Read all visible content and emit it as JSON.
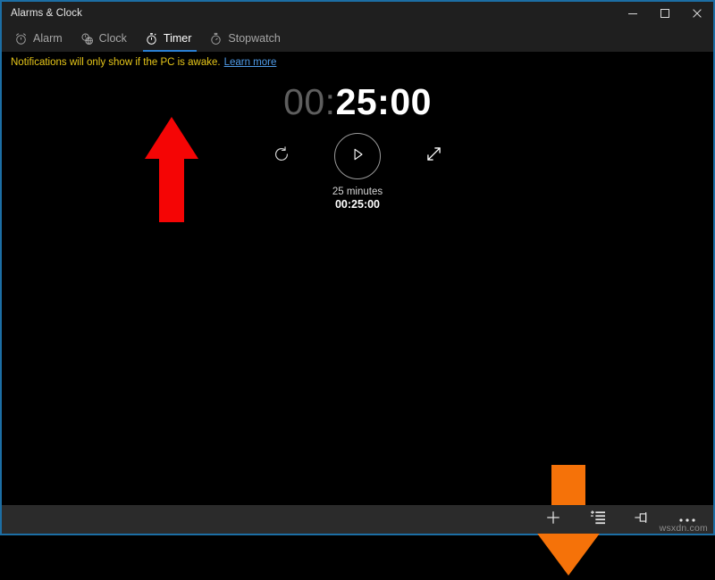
{
  "window": {
    "title": "Alarms & Clock",
    "accent_border_color": "#1c6ea4",
    "controls": [
      {
        "name": "minimize",
        "label": "Minimize"
      },
      {
        "name": "maximize",
        "label": "Maximize"
      },
      {
        "name": "close",
        "label": "Close"
      }
    ]
  },
  "tabs": [
    {
      "label": "Alarm",
      "icon": "alarm-clock-icon",
      "active": false
    },
    {
      "label": "Clock",
      "icon": "world-clock-icon",
      "active": false
    },
    {
      "label": "Timer",
      "icon": "timer-icon",
      "active": true
    },
    {
      "label": "Stopwatch",
      "icon": "stopwatch-icon",
      "active": false
    }
  ],
  "notification": {
    "message": "Notifications will only show if the PC is awake.",
    "link_label": "Learn more",
    "text_color": "#e6c619",
    "link_color": "#4f9be8"
  },
  "timer": {
    "readout_hours": "00:",
    "readout_rest": "25:00",
    "name": "25 minutes",
    "duration": "00:25:00",
    "reset_icon": "reset-icon",
    "play_icon": "play-icon",
    "expand_icon": "expand-icon"
  },
  "command_bar": {
    "buttons": [
      {
        "name": "add-timer-button",
        "icon": "plus-icon",
        "label": "New"
      },
      {
        "name": "expand-all-button",
        "icon": "list-expand-icon",
        "label": "Expand all"
      },
      {
        "name": "pin-button",
        "icon": "pin-icon",
        "label": "Pin"
      },
      {
        "name": "more-button",
        "icon": "ellipsis-icon",
        "label": "See more"
      }
    ]
  },
  "annotations": {
    "red_arrow": {
      "direction": "up",
      "color": "#f50505",
      "points_at": "Timer tab"
    },
    "orange_arrow": {
      "direction": "down",
      "color": "#f57209",
      "points_at": "Add timer button"
    }
  },
  "watermark": {
    "text": "wsxdn.com"
  }
}
